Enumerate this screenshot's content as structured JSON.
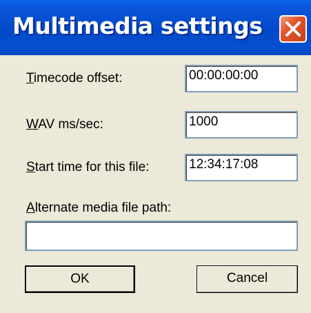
{
  "dialog": {
    "title": "Multimedia settings",
    "close_label": "✕"
  },
  "fields": {
    "timecode_offset": {
      "label_prefix": "",
      "label_hotkey": "T",
      "label_rest": "imecode offset:",
      "value": "00:00:00:00"
    },
    "wav_ms_sec": {
      "label_prefix": "",
      "label_hotkey": "W",
      "label_rest": "AV ms/sec:",
      "value": "1000"
    },
    "start_time": {
      "label_prefix": "",
      "label_hotkey": "S",
      "label_rest": "tart time for this file:",
      "value": "12:34:17:08"
    },
    "alternate_path": {
      "label_prefix": "",
      "label_hotkey": "A",
      "label_rest": "lternate media file path:",
      "value": ""
    }
  },
  "buttons": {
    "ok": "OK",
    "cancel": "Cancel"
  },
  "colors": {
    "titlebar": "#0049c9",
    "close": "#e3542a",
    "dialog_bg": "#ece9d8"
  }
}
